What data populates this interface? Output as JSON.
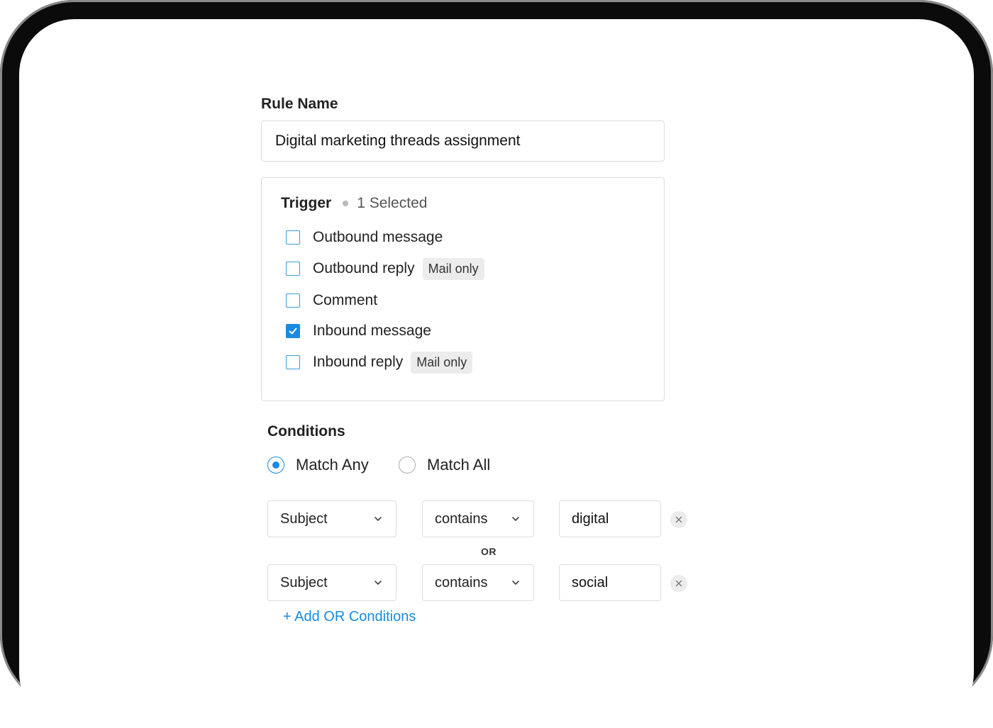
{
  "rule_name": {
    "label": "Rule Name",
    "value": "Digital marketing threads assignment"
  },
  "trigger": {
    "title": "Trigger",
    "selected_count": "1 Selected",
    "options": [
      {
        "label": "Outbound message",
        "checked": false,
        "badge": ""
      },
      {
        "label": "Outbound reply",
        "checked": false,
        "badge": "Mail only"
      },
      {
        "label": "Comment",
        "checked": false,
        "badge": ""
      },
      {
        "label": "Inbound message",
        "checked": true,
        "badge": ""
      },
      {
        "label": "Inbound reply",
        "checked": false,
        "badge": "Mail only"
      }
    ]
  },
  "conditions": {
    "title": "Conditions",
    "match_any_label": "Match Any",
    "match_all_label": "Match All",
    "selected_match": "Match Any",
    "rows": [
      {
        "field": "Subject",
        "operator": "contains",
        "value": "digital"
      },
      {
        "field": "Subject",
        "operator": "contains",
        "value": "social"
      }
    ],
    "joiner": "OR",
    "add_link": "+ Add OR Conditions"
  },
  "colors": {
    "accent": "#1a8ae0",
    "border": "#dcdcdc",
    "badge_bg": "#ececec"
  },
  "icons": {
    "check": "check-icon",
    "chevron": "chevron-down-icon",
    "clear": "close-icon"
  }
}
